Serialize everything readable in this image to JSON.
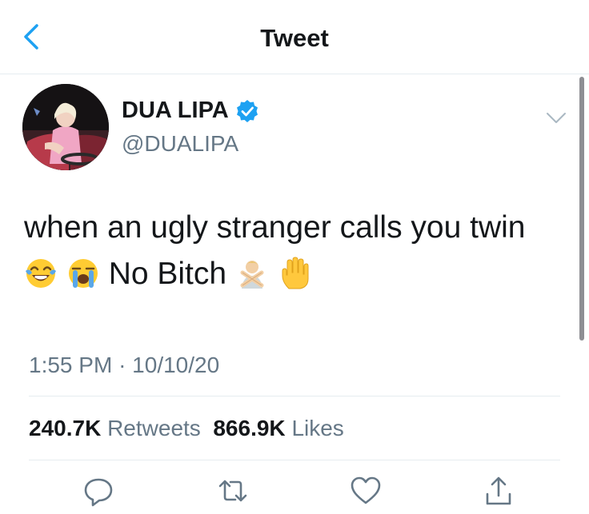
{
  "nav": {
    "title": "Tweet",
    "back_icon": "chevron-left-icon"
  },
  "author": {
    "display_name": "DUA LIPA",
    "handle": "@DUALIPA",
    "verified": true,
    "verified_icon": "verified-badge-icon",
    "menu_icon": "chevron-down-icon"
  },
  "tweet": {
    "line1": "when an ugly stranger calls you twin",
    "line2_text": "No Bitch",
    "emojis_before": [
      "face-with-tears-of-joy-icon",
      "loudly-crying-face-icon"
    ],
    "emojis_after": [
      "person-gesturing-no-icon",
      "raised-hand-icon"
    ]
  },
  "meta": {
    "time": "1:55 PM",
    "separator": "·",
    "date": "10/10/20"
  },
  "stats": {
    "retweets_count": "240.7K",
    "retweets_label": "Retweets",
    "likes_count": "866.9K",
    "likes_label": "Likes"
  },
  "actions": [
    {
      "name": "reply",
      "icon": "reply-bubble-icon"
    },
    {
      "name": "retweet",
      "icon": "retweet-icon"
    },
    {
      "name": "like",
      "icon": "heart-icon"
    },
    {
      "name": "share",
      "icon": "share-icon"
    }
  ],
  "colors": {
    "accent": "#1da1f2",
    "text_primary": "#14171a",
    "text_secondary": "#657786",
    "divider": "#e6ecf0"
  }
}
